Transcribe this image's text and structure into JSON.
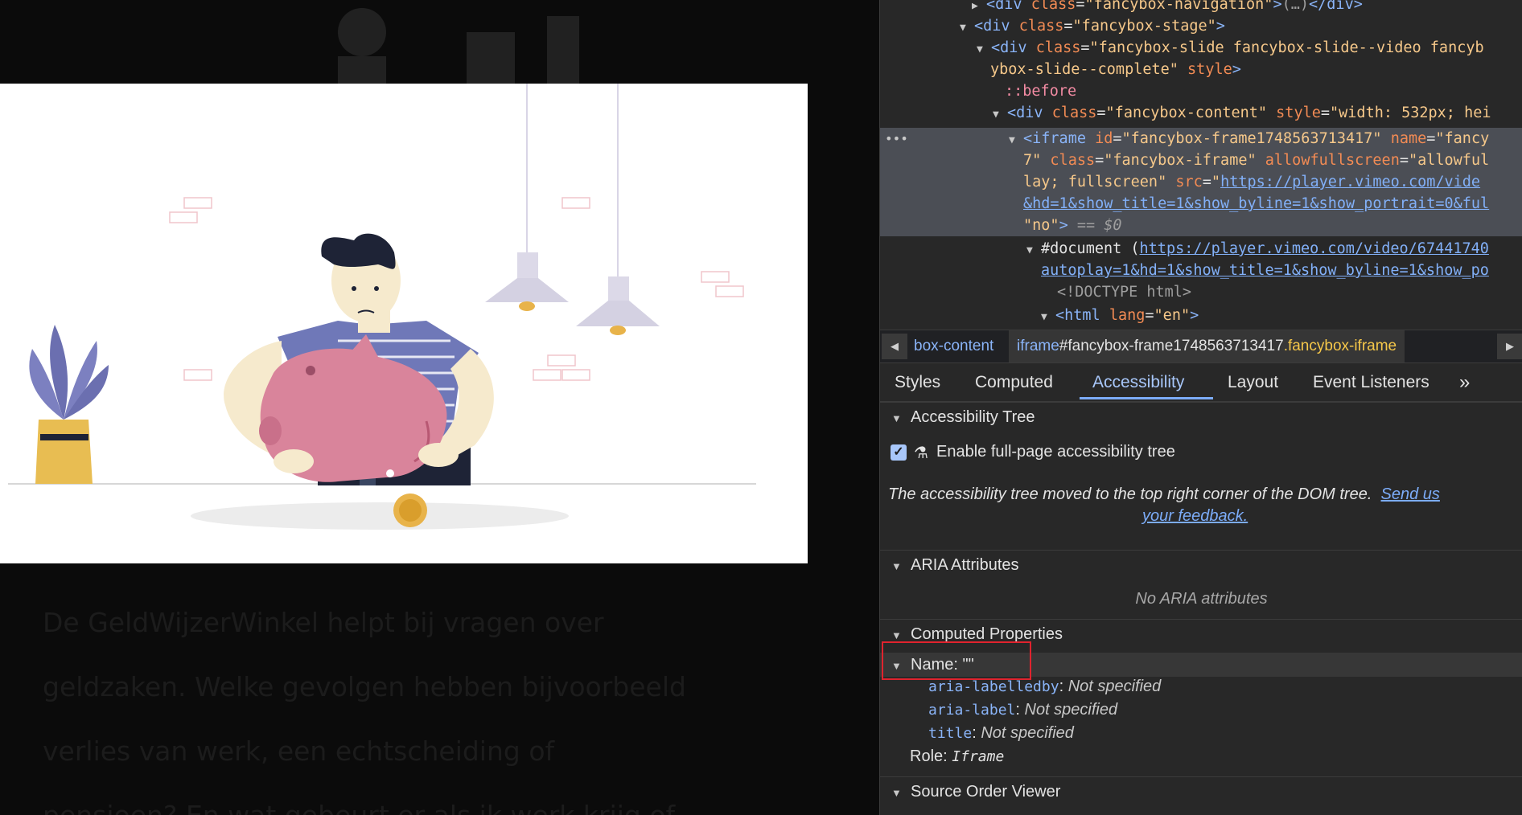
{
  "article": {
    "lines": [
      "De GeldWijzerWinkel helpt bij vragen over",
      "geldzaken. Welke gevolgen hebben bijvoorbeeld",
      "verlies van werk, een echtscheiding of",
      "pensioen? En wat gebeurt er als ik werk krijg of"
    ]
  },
  "devtools": {
    "dom": {
      "l1": {
        "tag": "<div",
        "attr": "class",
        "val": "\"fancybox-navigation\"",
        "rest": "</div>"
      },
      "l2": {
        "tag": "<div",
        "attr": "class",
        "val": "\"fancybox-stage\""
      },
      "l3": {
        "tag": "<div",
        "attr": "class",
        "val": "\"fancybox-slide fancybox-slide--video fancyb"
      },
      "l4": {
        "val": "ybox-slide--complete\"",
        "attr": "style"
      },
      "l5": {
        "pseudo": "::before"
      },
      "l6": {
        "tag": "<div",
        "attr": "class",
        "val": "\"fancybox-content\"",
        "attr2": "style",
        "val2": "\"width: 532px; hei"
      },
      "l7": {
        "tag": "<iframe",
        "attr": "id",
        "val": "\"fancybox-frame1748563713417\"",
        "attr2": "name",
        "val2": "\"fancy"
      },
      "l8": {
        "val": "7\"",
        "attr": "class",
        "val2": "\"fancybox-iframe\"",
        "attr2": "allowfullscreen",
        "val3": "\"allowful"
      },
      "l9": {
        "val": "lay; fullscreen\"",
        "attr": "src",
        "link": "https://player.vimeo.com/vide"
      },
      "l10": {
        "link": "&hd=1&show_title=1&show_byline=1&show_portrait=0&ful"
      },
      "l11": {
        "val": "\"no\"",
        "rest": "== $0"
      },
      "l12": {
        "text": "#document (",
        "link": "https://player.vimeo.com/video/67441740"
      },
      "l13": {
        "link": "autoplay=1&hd=1&show_title=1&show_byline=1&show_po"
      },
      "l14": {
        "text": "<!DOCTYPE html>"
      },
      "l15": {
        "tag": "<html",
        "attr": "lang",
        "val": "\"en\""
      }
    },
    "breadcrumb": {
      "item1": "box-content",
      "item2_tag": "iframe",
      "item2_id": "#fancybox-frame1748563713417",
      "item2_class": ".fancybox-iframe"
    },
    "tabs": [
      "Styles",
      "Computed",
      "Accessibility",
      "Layout",
      "Event Listeners",
      "»"
    ],
    "active_tab": "Accessibility",
    "sections": {
      "tree": "Accessibility Tree",
      "enable_label": "Enable full-page accessibility tree",
      "notice": "The accessibility tree moved to the top right corner of the DOM tree.",
      "feedback_a": "Send us",
      "feedback_b": "your feedback.",
      "aria": "ARIA Attributes",
      "no_aria": "No ARIA attributes",
      "computed": "Computed Properties",
      "name": "Name: \"\"",
      "props": [
        {
          "key": "aria-labelledby",
          "value": "Not specified"
        },
        {
          "key": "aria-label",
          "value": "Not specified"
        },
        {
          "key": "title",
          "value": "Not specified"
        }
      ],
      "role_label": "Role:",
      "role_value": "Iframe",
      "source_order": "Source Order Viewer"
    },
    "colors": {
      "accent": "#7cacf8",
      "highlight": "#e0232e",
      "selection": "#4b4e55"
    },
    "icons": [
      "expand-triangle-icon",
      "collapse-triangle-icon",
      "more-tabs-icon",
      "flask-icon",
      "checkbox-icon",
      "scroll-left-icon",
      "scroll-right-icon",
      "ellipsis-icon"
    ]
  }
}
